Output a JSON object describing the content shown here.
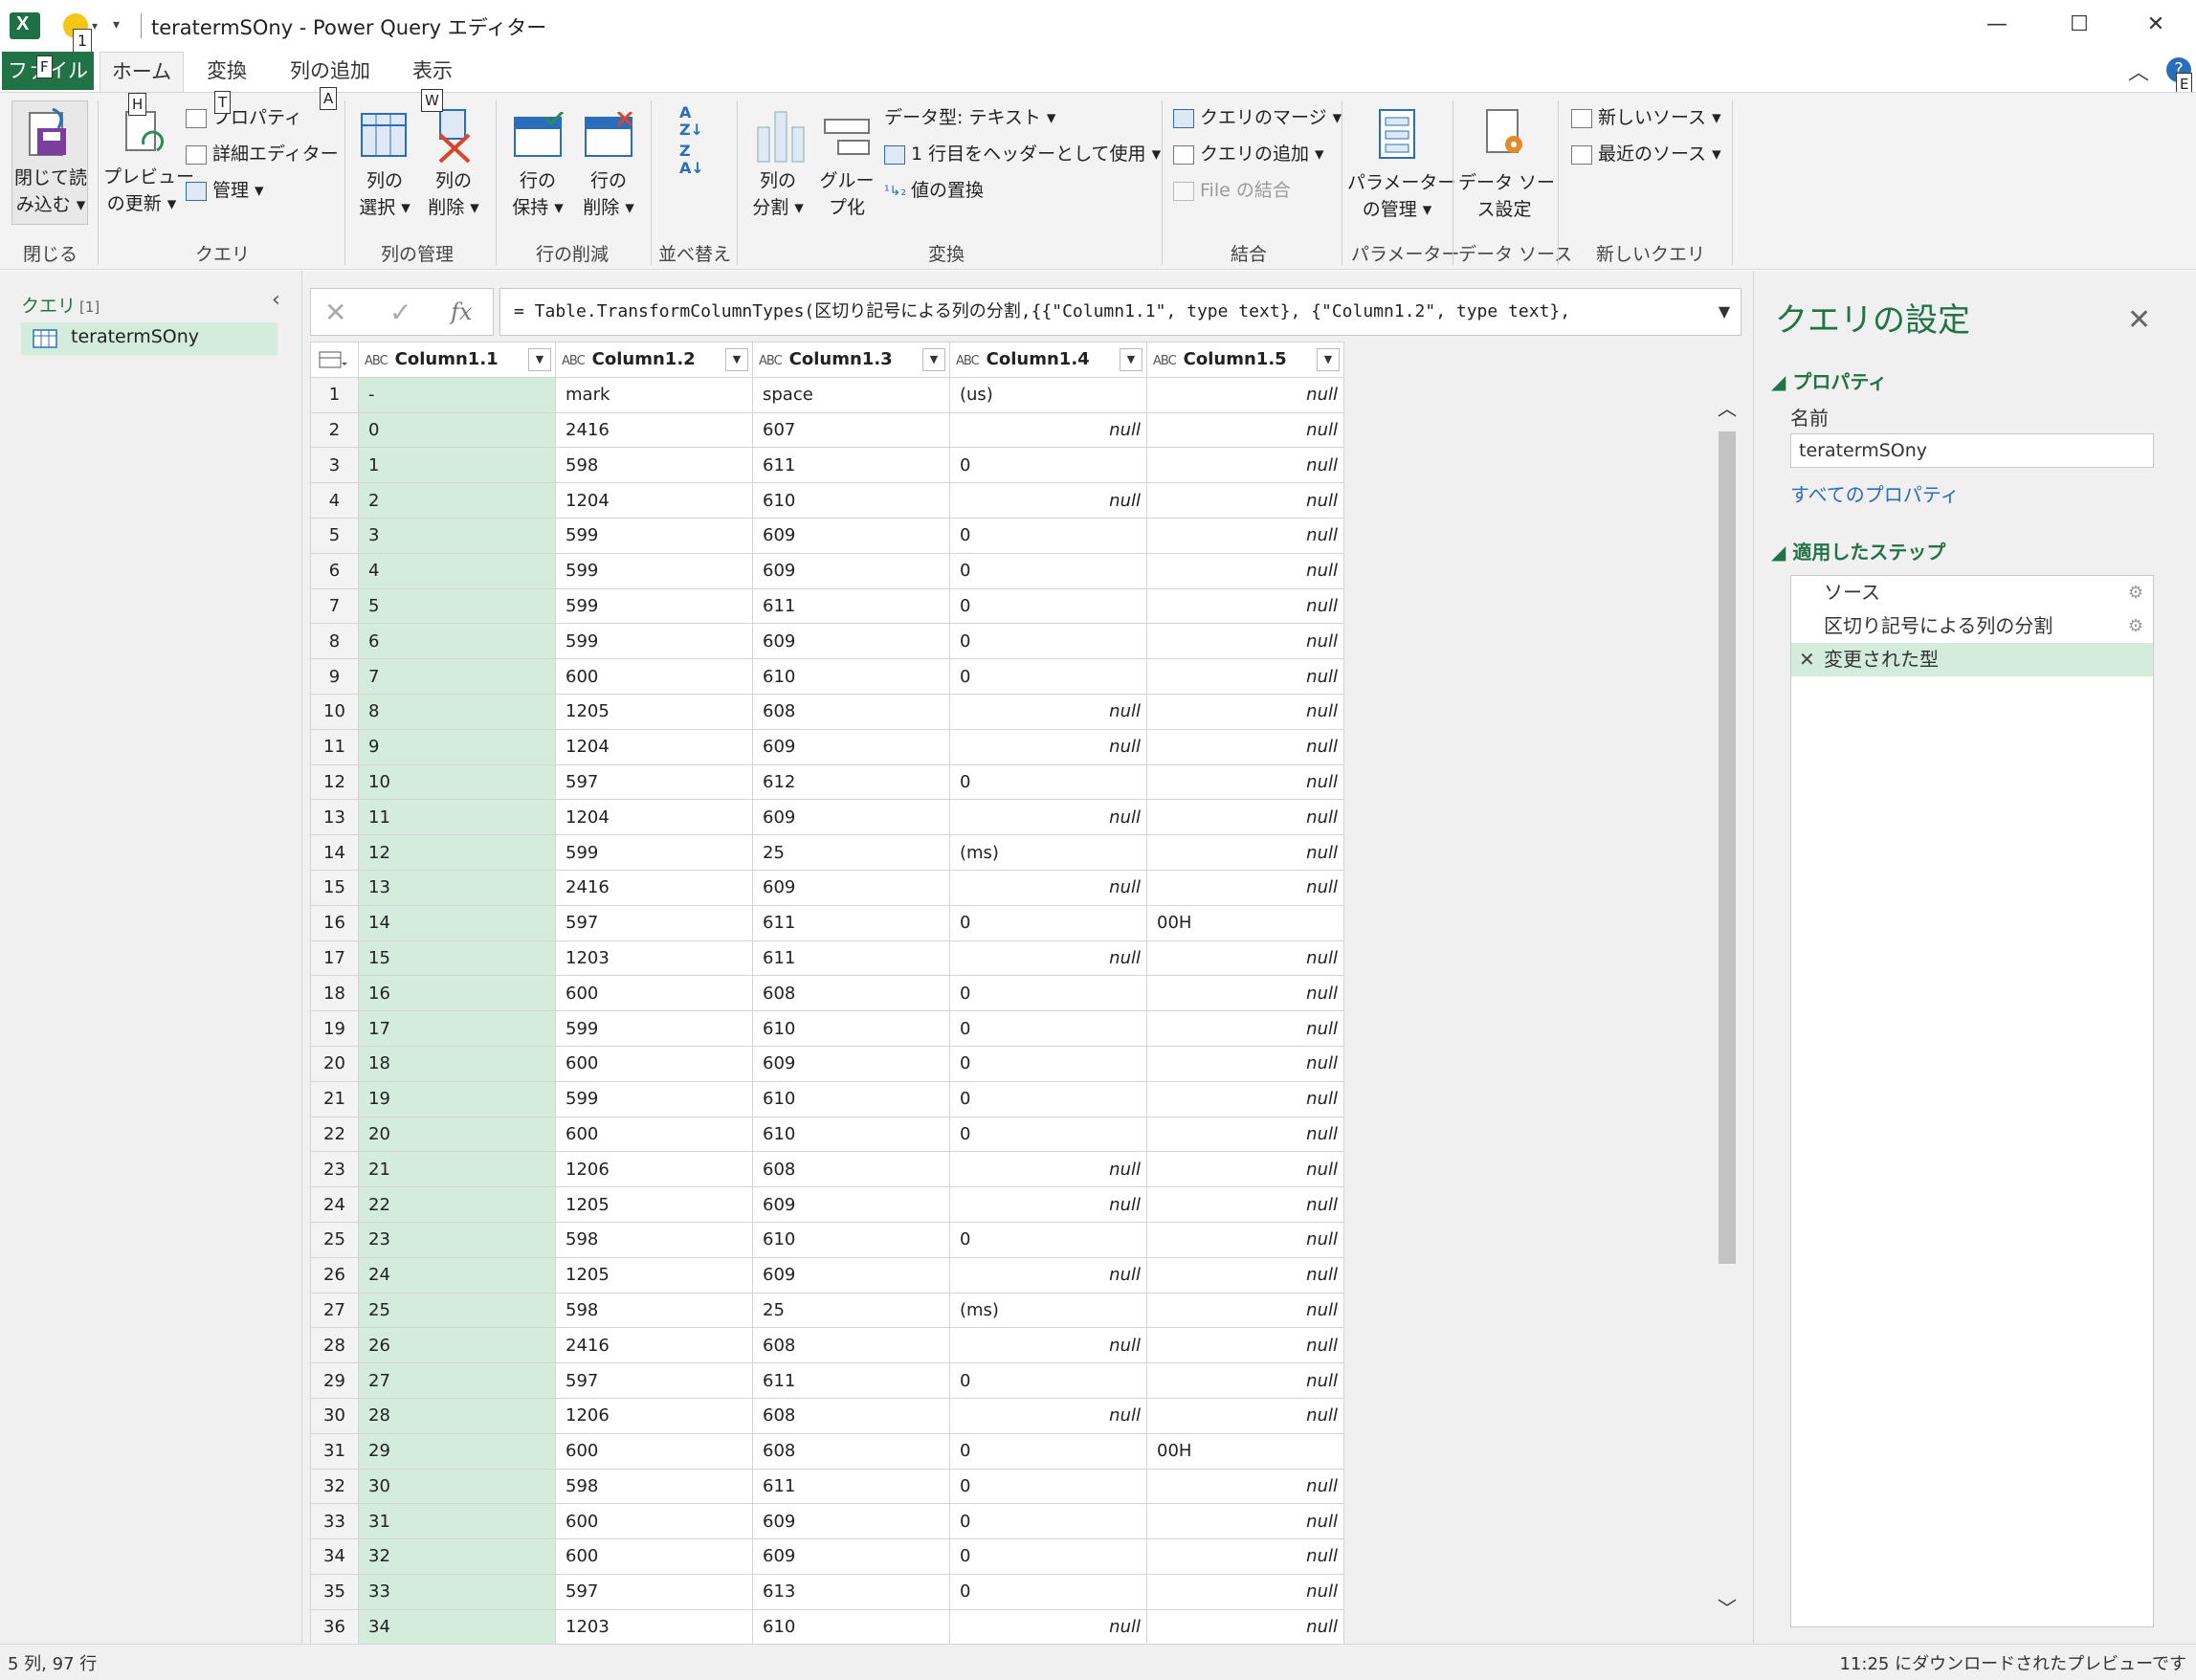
{
  "window": {
    "title": "teratermSOny - Power Query エディター",
    "minimize": "—",
    "maximize": "☐",
    "close": "✕",
    "qa_keytip": "1"
  },
  "ribbon_tabs": [
    {
      "label": "ファイル",
      "keytip": "F"
    },
    {
      "label": "ホーム",
      "keytip": "H"
    },
    {
      "label": "変換",
      "keytip": "T"
    },
    {
      "label": "列の追加",
      "keytip": "A"
    },
    {
      "label": "表示",
      "keytip": "W"
    }
  ],
  "ribbon_collapse": "︿",
  "help": "?",
  "help_keytip": "E",
  "ribbon": {
    "close_group": {
      "big_btn_line1": "閉じて読",
      "big_btn_line2": "み込む ▾",
      "label": "閉じる"
    },
    "query_group": {
      "refresh_line1": "プレビュー",
      "refresh_line2": "の更新 ▾",
      "properties": "プロパティ",
      "advanced_editor": "詳細エディター",
      "manage": "管理 ▾",
      "label": "クエリ"
    },
    "columns_group": {
      "choose_line1": "列の",
      "choose_line2": "選択 ▾",
      "remove_line1": "列の",
      "remove_line2": "削除 ▾",
      "label": "列の管理"
    },
    "rows_group": {
      "keep_line1": "行の",
      "keep_line2": "保持 ▾",
      "remove_line1": "行の",
      "remove_line2": "削除 ▾",
      "label": "行の削減"
    },
    "sort_group": {
      "label": "並べ替え"
    },
    "transform_group": {
      "split_line1": "列の",
      "split_line2": "分割 ▾",
      "group_line1": "グルー",
      "group_line2": "プ化",
      "data_type": "データ型: テキスト ▾",
      "use_header": "1 行目をヘッダーとして使用 ▾",
      "replace": "値の置換",
      "label": "変換"
    },
    "combine_group": {
      "merge": "クエリのマージ ▾",
      "append": "クエリの追加 ▾",
      "combine_files": "File の結合",
      "label": "結合"
    },
    "params_group": {
      "line1": "パラメーター",
      "line2": "の管理 ▾",
      "label": "パラメーター"
    },
    "datasource_group": {
      "line1": "データ ソー",
      "line2": "ス設定",
      "label": "データ ソース"
    },
    "newquery_group": {
      "new_source": "新しいソース ▾",
      "recent_source": "最近のソース ▾",
      "label": "新しいクエリ"
    }
  },
  "queries_pane": {
    "header": "クエリ",
    "count": "[1]",
    "collapse": "‹",
    "items": [
      "teratermSOny"
    ]
  },
  "formula_bar": {
    "cancel": "✕",
    "commit": "✓",
    "fx": "fx",
    "formula": "= Table.TransformColumnTypes(区切り記号による列の分割,{{\"Column1.1\", type text}, {\"Column1.2\", type text},",
    "expand": "▼"
  },
  "grid": {
    "type_icon": "ABC",
    "dropdown": "▼",
    "columns": [
      "Column1.1",
      "Column1.2",
      "Column1.3",
      "Column1.4",
      "Column1.5"
    ],
    "rows": [
      [
        "1",
        "-",
        "mark",
        "space",
        "(us)",
        "null"
      ],
      [
        "2",
        "0",
        "2416",
        "607",
        "null",
        "null"
      ],
      [
        "3",
        "1",
        "598",
        "611",
        "0",
        "null"
      ],
      [
        "4",
        "2",
        "1204",
        "610",
        "null",
        "null"
      ],
      [
        "5",
        "3",
        "599",
        "609",
        "0",
        "null"
      ],
      [
        "6",
        "4",
        "599",
        "609",
        "0",
        "null"
      ],
      [
        "7",
        "5",
        "599",
        "611",
        "0",
        "null"
      ],
      [
        "8",
        "6",
        "599",
        "609",
        "0",
        "null"
      ],
      [
        "9",
        "7",
        "600",
        "610",
        "0",
        "null"
      ],
      [
        "10",
        "8",
        "1205",
        "608",
        "null",
        "null"
      ],
      [
        "11",
        "9",
        "1204",
        "609",
        "null",
        "null"
      ],
      [
        "12",
        "10",
        "597",
        "612",
        "0",
        "null"
      ],
      [
        "13",
        "11",
        "1204",
        "609",
        "null",
        "null"
      ],
      [
        "14",
        "12",
        "599",
        "25",
        "(ms)",
        "null"
      ],
      [
        "15",
        "13",
        "2416",
        "609",
        "null",
        "null"
      ],
      [
        "16",
        "14",
        "597",
        "611",
        "0",
        "00H"
      ],
      [
        "17",
        "15",
        "1203",
        "611",
        "null",
        "null"
      ],
      [
        "18",
        "16",
        "600",
        "608",
        "0",
        "null"
      ],
      [
        "19",
        "17",
        "599",
        "610",
        "0",
        "null"
      ],
      [
        "20",
        "18",
        "600",
        "609",
        "0",
        "null"
      ],
      [
        "21",
        "19",
        "599",
        "610",
        "0",
        "null"
      ],
      [
        "22",
        "20",
        "600",
        "610",
        "0",
        "null"
      ],
      [
        "23",
        "21",
        "1206",
        "608",
        "null",
        "null"
      ],
      [
        "24",
        "22",
        "1205",
        "609",
        "null",
        "null"
      ],
      [
        "25",
        "23",
        "598",
        "610",
        "0",
        "null"
      ],
      [
        "26",
        "24",
        "1205",
        "609",
        "null",
        "null"
      ],
      [
        "27",
        "25",
        "598",
        "25",
        "(ms)",
        "null"
      ],
      [
        "28",
        "26",
        "2416",
        "608",
        "null",
        "null"
      ],
      [
        "29",
        "27",
        "597",
        "611",
        "0",
        "null"
      ],
      [
        "30",
        "28",
        "1206",
        "608",
        "null",
        "null"
      ],
      [
        "31",
        "29",
        "600",
        "608",
        "0",
        "00H"
      ],
      [
        "32",
        "30",
        "598",
        "611",
        "0",
        "null"
      ],
      [
        "33",
        "31",
        "600",
        "609",
        "0",
        "null"
      ],
      [
        "34",
        "32",
        "600",
        "609",
        "0",
        "null"
      ],
      [
        "35",
        "33",
        "597",
        "613",
        "0",
        "null"
      ],
      [
        "36",
        "34",
        "1203",
        "610",
        "null",
        "null"
      ]
    ]
  },
  "scrollbar": {
    "up": "︿",
    "down": "﹀"
  },
  "settings": {
    "title": "クエリの設定",
    "close": "✕",
    "properties_title": "◢ プロパティ",
    "name_label": "名前",
    "name_value": "teratermSOny",
    "all_properties": "すべてのプロパティ",
    "steps_title": "◢ 適用したステップ",
    "steps": [
      {
        "label": "ソース",
        "gear": "⚙"
      },
      {
        "label": "区切り記号による列の分割",
        "gear": "⚙"
      },
      {
        "label": "変更された型",
        "delete": "✕"
      }
    ]
  },
  "status": {
    "left": "5 列, 97 行",
    "right": "11:25 にダウンロードされたプレビューです"
  }
}
